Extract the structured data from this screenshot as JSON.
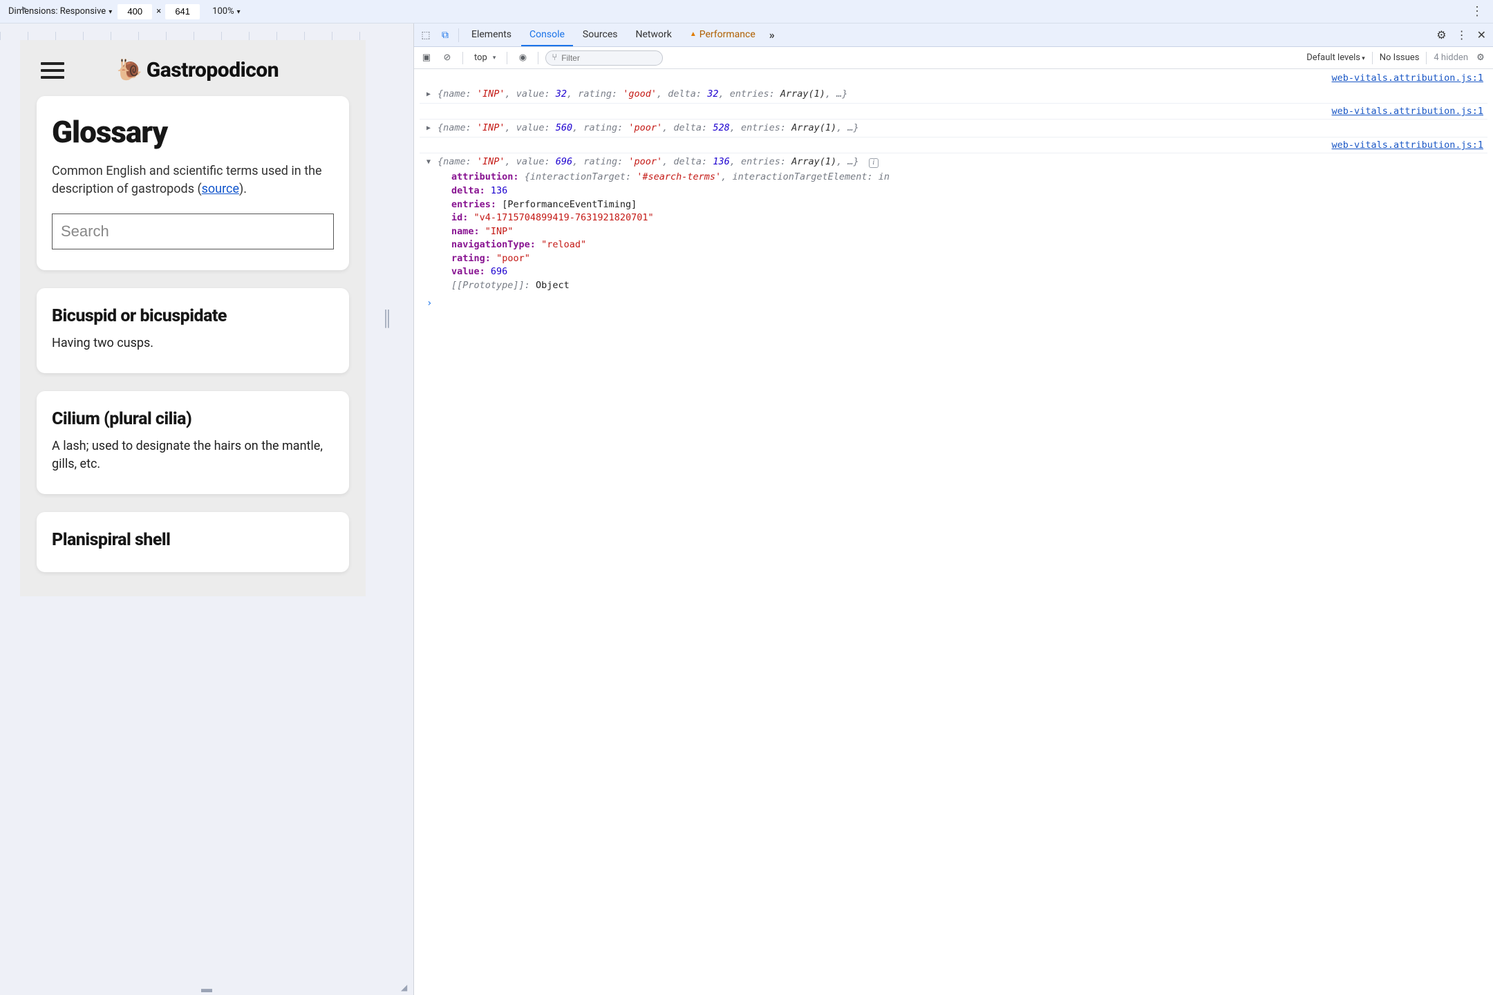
{
  "deviceToolbar": {
    "dimensionsLabel": "Dimensions: Responsive",
    "width": "400",
    "height": "641",
    "zoom": "100%"
  },
  "site": {
    "brand": "Gastropodicon",
    "glossary": {
      "title": "Glossary",
      "descPrefix": "Common English and scientific terms used in the description of gastropods (",
      "sourceLabel": "source",
      "descSuffix": ").",
      "searchPlaceholder": "Search"
    },
    "terms": [
      {
        "title": "Bicuspid or bicuspidate",
        "def": "Having two cusps."
      },
      {
        "title": "Cilium (plural cilia)",
        "def": "A lash; used to designate the hairs on the mantle, gills, etc."
      },
      {
        "title": "Planispiral shell",
        "def": ""
      }
    ]
  },
  "devtools": {
    "tabs": {
      "elements": "Elements",
      "console": "Console",
      "sources": "Sources",
      "network": "Network",
      "performance": "Performance"
    },
    "toolbar": {
      "context": "top",
      "filterPlaceholder": "Filter",
      "levels": "Default levels",
      "issues": "No Issues",
      "hidden": "4 hidden"
    },
    "source": "web-vitals.attribution.js:1",
    "logs": [
      {
        "name": "'INP'",
        "value": "32",
        "rating": "'good'",
        "delta": "32",
        "entries": "Array(1)",
        "suffix": ", …}"
      },
      {
        "name": "'INP'",
        "value": "560",
        "rating": "'poor'",
        "delta": "528",
        "entries": "Array(1)",
        "suffix": ", …}"
      },
      {
        "name": "'INP'",
        "value": "696",
        "rating": "'poor'",
        "delta": "136",
        "entries": "Array(1)",
        "suffix": ", …}"
      }
    ],
    "expanded": {
      "attribution": {
        "interactionTarget": "'#search-terms'",
        "tail": "interactionTargetElement: in"
      },
      "delta": "136",
      "entries": "[PerformanceEventTiming]",
      "id": "\"v4-1715704899419-7631921820701\"",
      "name": "\"INP\"",
      "navigationType": "\"reload\"",
      "rating": "\"poor\"",
      "value": "696",
      "proto": "Object"
    }
  }
}
